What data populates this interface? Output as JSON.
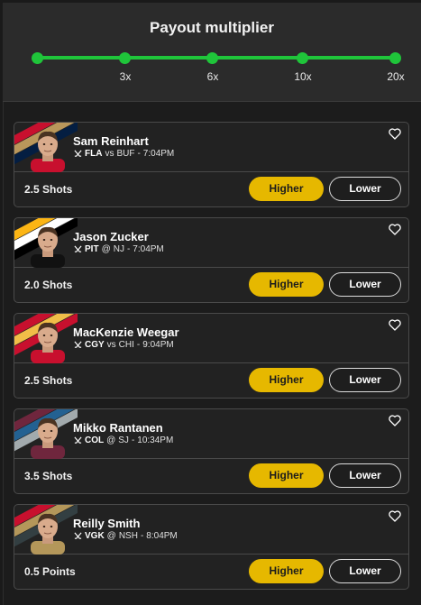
{
  "header": {
    "title": "Payout multiplier",
    "track_color": "#1fc53a",
    "ticks": [
      "",
      "3x",
      "6x",
      "10x",
      "20x"
    ]
  },
  "buttons": {
    "higher": "Higher",
    "lower": "Lower"
  },
  "players": [
    {
      "name": "Sam Reinhart",
      "team": "FLA",
      "sep": "vs",
      "opp": "BUF",
      "time": "7:04PM",
      "line": "2.5 Shots",
      "stripes": [
        "#c8102e",
        "#b9975b",
        "#041e42"
      ],
      "jersey": "#c8102e"
    },
    {
      "name": "Jason Zucker",
      "team": "PIT",
      "sep": "@",
      "opp": "NJ",
      "time": "7:04PM",
      "line": "2.0 Shots",
      "stripes": [
        "#fcb514",
        "#ffffff",
        "#000000"
      ],
      "jersey": "#111111"
    },
    {
      "name": "MacKenzie Weegar",
      "team": "CGY",
      "sep": "vs",
      "opp": "CHI",
      "time": "9:04PM",
      "line": "2.5 Shots",
      "stripes": [
        "#c8102e",
        "#f1be48",
        "#c8102e"
      ],
      "jersey": "#c8102e"
    },
    {
      "name": "Mikko Rantanen",
      "team": "COL",
      "sep": "@",
      "opp": "SJ",
      "time": "10:34PM",
      "line": "3.5 Shots",
      "stripes": [
        "#6f263d",
        "#236192",
        "#a2aaad"
      ],
      "jersey": "#6f263d"
    },
    {
      "name": "Reilly Smith",
      "team": "VGK",
      "sep": "@",
      "opp": "NSH",
      "time": "8:04PM",
      "line": "0.5 Points",
      "stripes": [
        "#c8102e",
        "#b4975a",
        "#333f42"
      ],
      "jersey": "#b4975a"
    }
  ]
}
